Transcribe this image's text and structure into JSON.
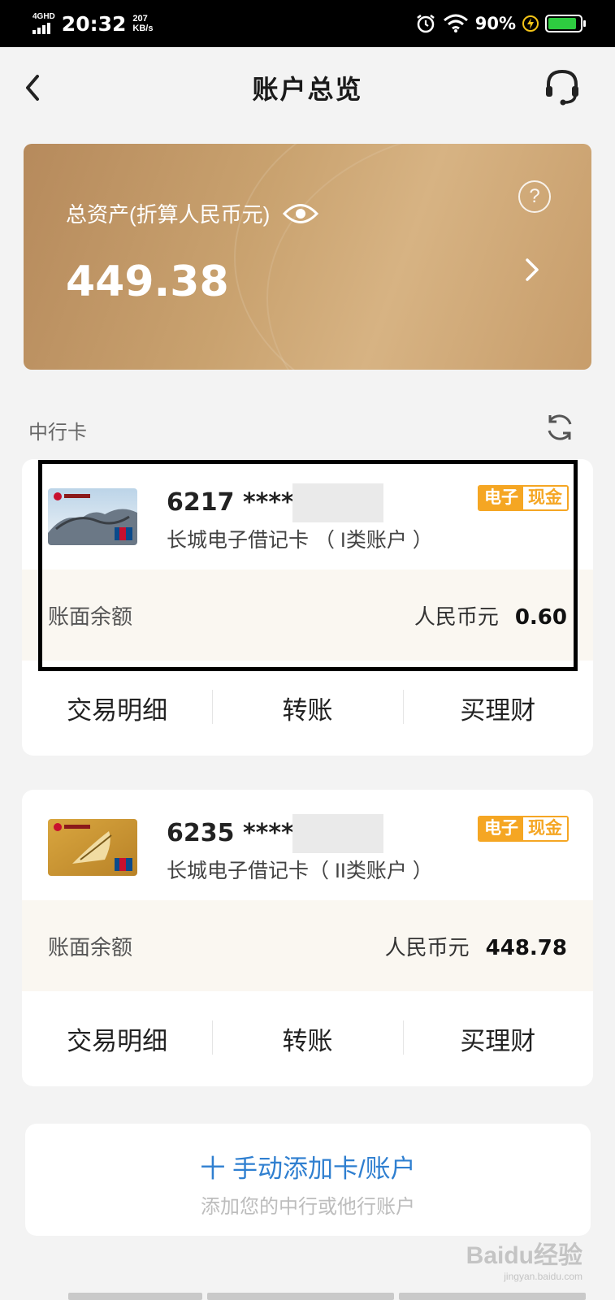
{
  "status_bar": {
    "network": "4GHD",
    "time": "20:32",
    "speed_value": "207",
    "speed_unit": "KB/s",
    "battery": "90%"
  },
  "header": {
    "title": "账户总览"
  },
  "asset": {
    "label": "总资产(折算人民币元)",
    "value": "449.38",
    "help": "?"
  },
  "section": {
    "title": "中行卡"
  },
  "cards": [
    {
      "number": "6217 ******",
      "name": "长城电子借记卡 （ I类账户 ）",
      "badge_a": "电子",
      "badge_b": "现金",
      "balance_label": "账面余额",
      "currency": "人民币元",
      "amount": "0.60",
      "actions": [
        "交易明细",
        "转账",
        "买理财"
      ]
    },
    {
      "number": "6235 ******",
      "name": "长城电子借记卡（ II类账户 ）",
      "badge_a": "电子",
      "badge_b": "现金",
      "balance_label": "账面余额",
      "currency": "人民币元",
      "amount": "448.78",
      "actions": [
        "交易明细",
        "转账",
        "买理财"
      ]
    }
  ],
  "add_card": {
    "title": "十 手动添加卡/账户",
    "subtitle": "添加您的中行或他行账户"
  },
  "watermark": {
    "text": "Baidu经验",
    "sub": "jingyan.baidu.com"
  },
  "colors": {
    "accent_blue": "#2f7fd0",
    "badge_orange": "#f5a623",
    "asset_gold": "#c9a26f"
  }
}
